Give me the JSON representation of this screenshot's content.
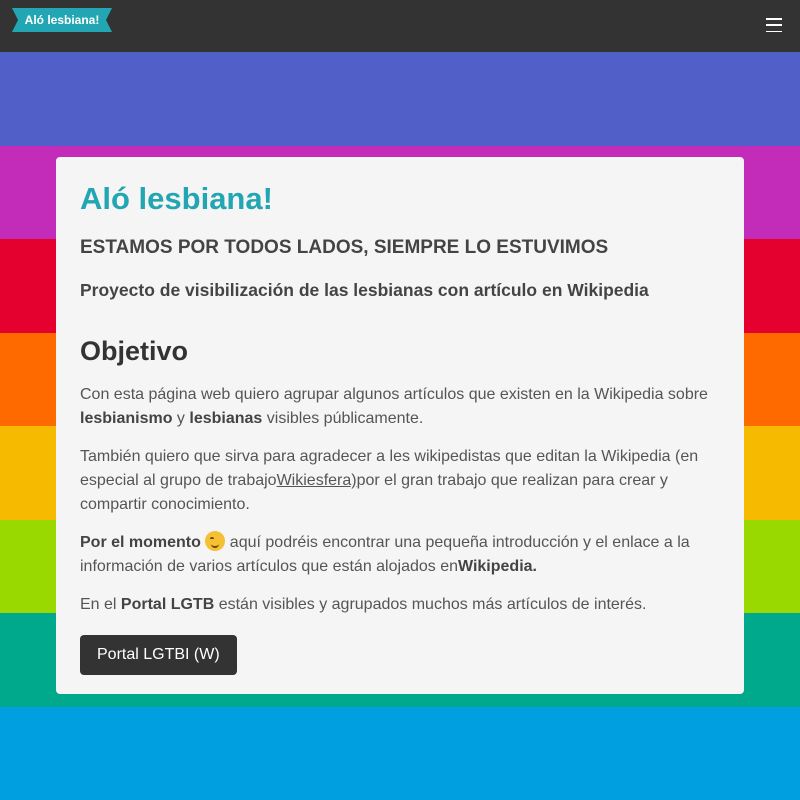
{
  "header": {
    "logo_text": "Aló lesbiana!",
    "menu_icon": "hamburger-menu-icon"
  },
  "background": {
    "stripes": [
      {
        "color": "#5160c9"
      },
      {
        "color": "#c22cb8"
      },
      {
        "color": "#e4002f"
      },
      {
        "color": "#fe6a00"
      },
      {
        "color": "#f6bb00"
      },
      {
        "color": "#99d900"
      },
      {
        "color": "#00a88c"
      },
      {
        "color": "#009fe0"
      }
    ]
  },
  "card": {
    "title": "Aló lesbiana!",
    "subtitle": "ESTAMOS POR TODOS LADOS, SIEMPRE LO ESTUVIMOS",
    "tagline": "Proyecto de visibilización de las lesbianas con artículo en Wikipedia",
    "section_heading": "Objetivo",
    "p1": {
      "t1": "Con esta página web quiero agrupar algunos artículos que existen en la Wikipedia sobre ",
      "b1": "lesbianismo",
      "t2": " y ",
      "b2": "lesbianas",
      "t3": " visibles públicamente."
    },
    "p2": {
      "t1": "También quiero que sirva para agradecer a les wikipedistas que editan la Wikipedia (en especial al grupo de trabajo",
      "link": "Wikiesfera)",
      "t2": "por el gran trabajo que realizan para crear y compartir conocimiento."
    },
    "p3": {
      "b1": "Por el momento",
      "emoji": "winking-face-icon",
      "t1": " aquí podréis encontrar una pequeña introducción y el enlace a la información de varios artículos que están alojados en",
      "b2": "Wikipedia."
    },
    "p4": {
      "t1": "En el ",
      "b1": "Portal LGTB",
      "t2": " están visibles y agrupados muchos más artículos de interés."
    },
    "button_label": "Portal LGTBI (W)"
  },
  "colors": {
    "accent": "#22a6b3",
    "header_bg": "#333333",
    "card_bg": "#f5f5f5",
    "button_bg": "#333333"
  }
}
